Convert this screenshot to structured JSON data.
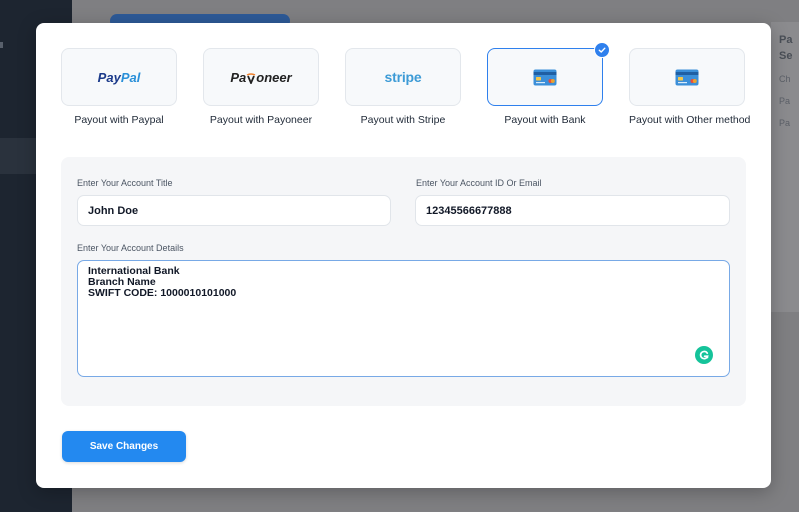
{
  "background": {
    "right_title_lines": [
      "Pa",
      "Se"
    ],
    "right_sub_lines": [
      "Ch",
      "Pa",
      "Pa"
    ]
  },
  "modal": {
    "payout_options": [
      {
        "label": "Payout with Paypal",
        "logo": {
          "pay": "Pay",
          "pal": "Pal"
        },
        "selected": false
      },
      {
        "label": "Payout with Payoneer",
        "logo": {
          "pre": "Pa",
          "post": "oneer"
        },
        "selected": false
      },
      {
        "label": "Payout with Stripe",
        "logo": {
          "text": "stripe"
        },
        "selected": false
      },
      {
        "label": "Payout with Bank",
        "icon": "bank-card-icon",
        "selected": true
      },
      {
        "label": "Payout with Other method",
        "icon": "bank-card-icon",
        "selected": false
      }
    ],
    "form": {
      "title_label": "Enter Your Account Title",
      "title_value": "John Doe",
      "id_label": "Enter Your Account ID Or Email",
      "id_value": "12345566677888",
      "details_label": "Enter Your Account Details",
      "details_lines": [
        "International Bank",
        "Branch Name",
        "SWIFT CODE: 1000010101000"
      ]
    },
    "save_label": "Save Changes"
  },
  "colors": {
    "accent": "#2f80ed",
    "button": "#2389f0",
    "paypal_dark": "#1b3a8a",
    "paypal_light": "#2a90d9",
    "stripe": "#3d9bd6",
    "grammarly": "#15c39a"
  }
}
